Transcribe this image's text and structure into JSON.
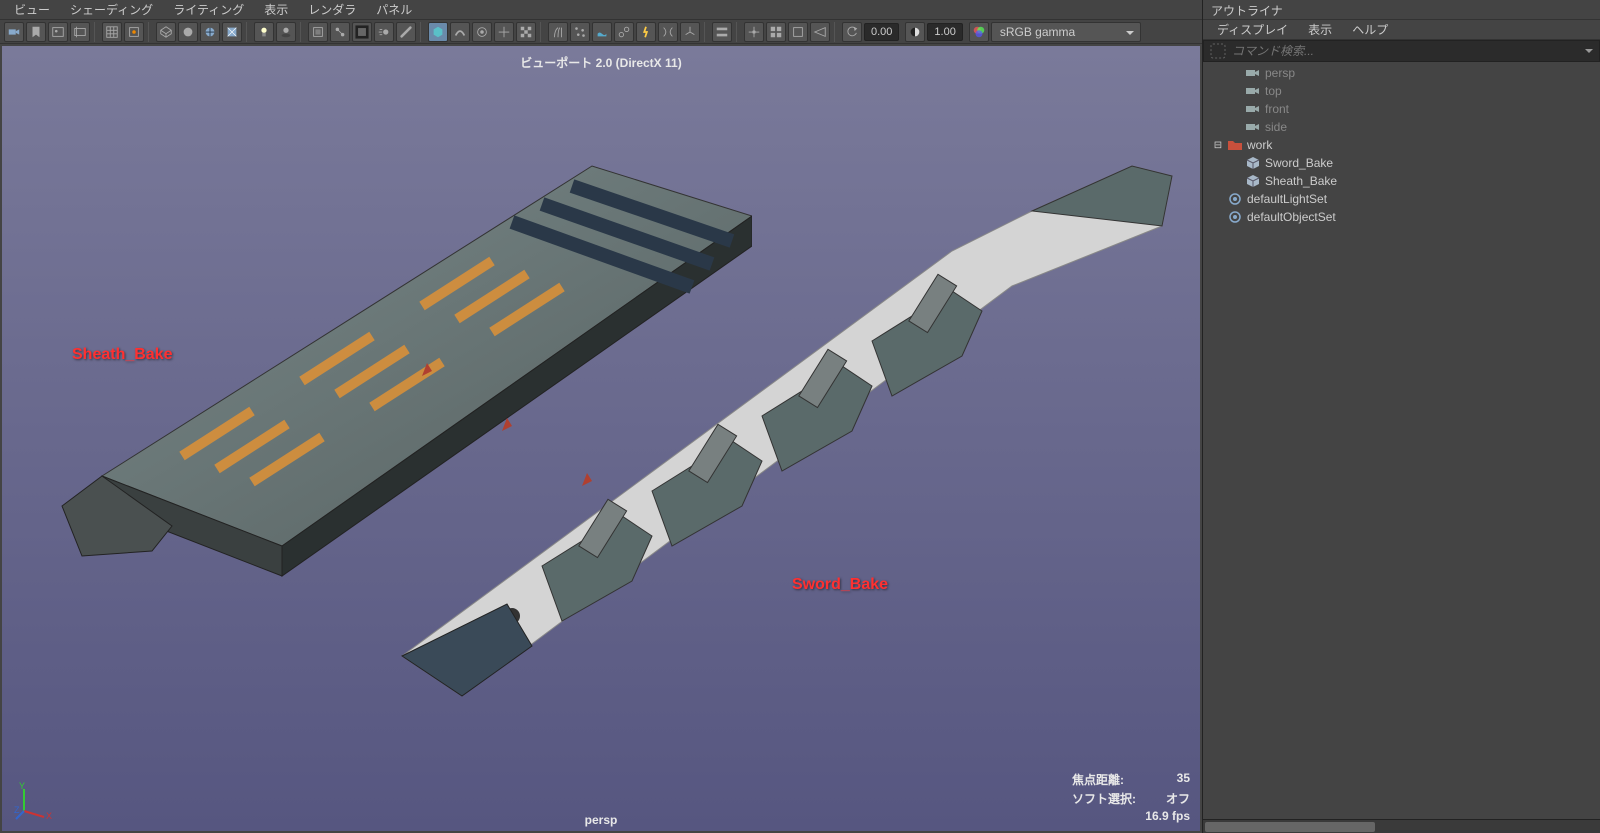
{
  "viewport": {
    "menu": [
      "ビュー",
      "シェーディング",
      "ライティング",
      "表示",
      "レンダラ",
      "パネル"
    ],
    "fields": {
      "f1": "0.00",
      "f2": "1.00"
    },
    "gamma_dropdown": "sRGB gamma",
    "header_text": "ビューポート 2.0 (DirectX 11)",
    "annotations": {
      "sheath": "Sheath_Bake",
      "sword": "Sword_Bake"
    },
    "bottom_label": "persp",
    "stats": {
      "focal_label": "焦点距離:",
      "focal_value": "35",
      "soft_label": "ソフト選択:",
      "soft_value": "オフ",
      "fps": "16.9 fps"
    }
  },
  "outliner": {
    "title": "アウトライナ",
    "menu": [
      "ディスプレイ",
      "表示",
      "ヘルプ"
    ],
    "search_placeholder": "コマンド検索...",
    "items": [
      {
        "label": "persp",
        "type": "camera",
        "indent": 1,
        "dim": true
      },
      {
        "label": "top",
        "type": "camera",
        "indent": 1,
        "dim": true
      },
      {
        "label": "front",
        "type": "camera",
        "indent": 1,
        "dim": true
      },
      {
        "label": "side",
        "type": "camera",
        "indent": 1,
        "dim": true
      },
      {
        "label": "work",
        "type": "folder",
        "indent": 0,
        "expanded": true
      },
      {
        "label": "Sword_Bake",
        "type": "mesh",
        "indent": 1
      },
      {
        "label": "Sheath_Bake",
        "type": "mesh",
        "indent": 1
      },
      {
        "label": "defaultLightSet",
        "type": "set",
        "indent": 0
      },
      {
        "label": "defaultObjectSet",
        "type": "set",
        "indent": 0
      }
    ]
  }
}
